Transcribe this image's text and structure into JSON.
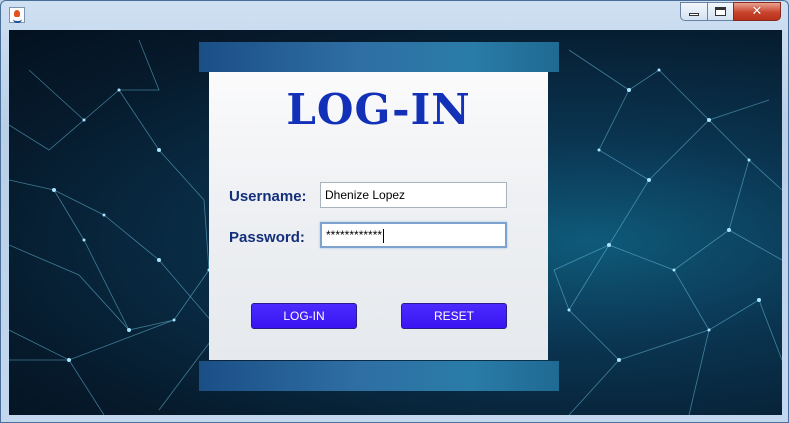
{
  "window": {
    "app_icon": "java-icon",
    "controls": [
      "minimize-icon",
      "maximize-icon",
      "close-icon"
    ]
  },
  "login": {
    "title": "LOG-IN",
    "username_label": "Username:",
    "username_value": "Dhenize Lopez",
    "password_label": "Password:",
    "password_value": "************",
    "login_button": "LOG-IN",
    "reset_button": "RESET"
  },
  "colors": {
    "title": "#1231b8",
    "label": "#142f7a",
    "button": "#3a14f2",
    "background": "#061b2d"
  }
}
